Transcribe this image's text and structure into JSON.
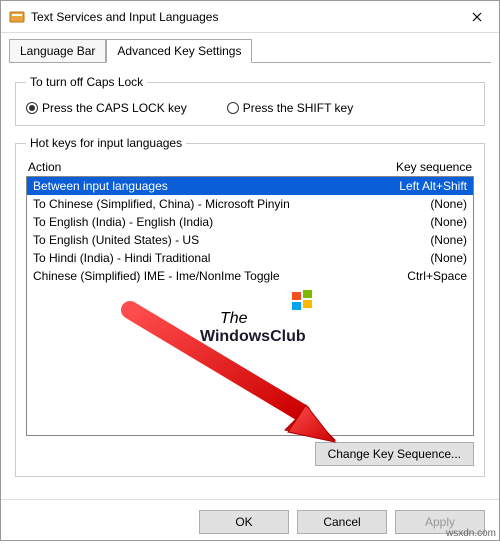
{
  "window": {
    "title": "Text Services and Input Languages"
  },
  "tabs": {
    "language_bar": "Language Bar",
    "advanced": "Advanced Key Settings"
  },
  "caps_group": {
    "legend": "To turn off Caps Lock",
    "opt_capslock": "Press the CAPS LOCK key",
    "opt_shift": "Press the SHIFT key"
  },
  "hotkeys_group": {
    "legend": "Hot keys for input languages",
    "col_action": "Action",
    "col_keyseq": "Key sequence",
    "rows": [
      {
        "action": "Between input languages",
        "key": "Left Alt+Shift",
        "selected": true
      },
      {
        "action": "To Chinese (Simplified, China) - Microsoft Pinyin",
        "key": "(None)",
        "selected": false
      },
      {
        "action": "To English (India) - English (India)",
        "key": "(None)",
        "selected": false
      },
      {
        "action": "To English (United States) - US",
        "key": "(None)",
        "selected": false
      },
      {
        "action": "To Hindi (India) - Hindi Traditional",
        "key": "(None)",
        "selected": false
      },
      {
        "action": "Chinese (Simplified) IME - Ime/NonIme Toggle",
        "key": "Ctrl+Space",
        "selected": false
      }
    ],
    "change_btn": "Change Key Sequence..."
  },
  "buttons": {
    "ok": "OK",
    "cancel": "Cancel",
    "apply": "Apply"
  },
  "watermark": {
    "line1": "The",
    "line2": "WindowsClub"
  },
  "footer_mark": "wsxdn.com"
}
